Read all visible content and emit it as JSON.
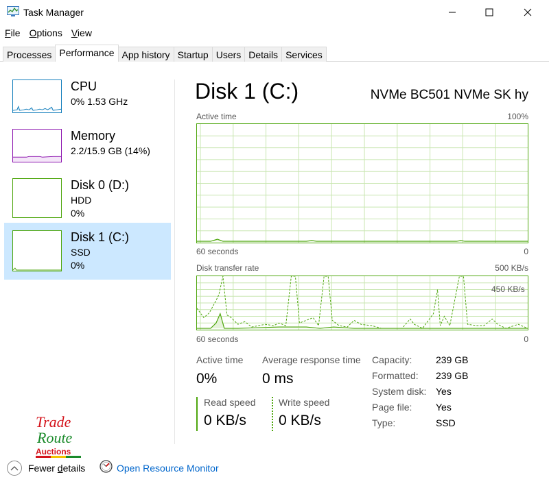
{
  "window": {
    "title": "Task Manager",
    "icon": "task-manager-icon"
  },
  "menu": [
    {
      "key": "F",
      "rest": "ile"
    },
    {
      "key": "O",
      "rest": "ptions"
    },
    {
      "key": "V",
      "rest": "iew"
    }
  ],
  "tabs": [
    "Processes",
    "Performance",
    "App history",
    "Startup",
    "Users",
    "Details",
    "Services"
  ],
  "active_tab": "Performance",
  "sidebar": {
    "items": [
      {
        "title": "CPU",
        "line1": "0%  1.53 GHz",
        "line2": ""
      },
      {
        "title": "Memory",
        "line1": "2.2/15.9 GB (14%)",
        "line2": ""
      },
      {
        "title": "Disk 0 (D:)",
        "line1": "HDD",
        "line2": "0%"
      },
      {
        "title": "Disk 1 (C:)",
        "line1": "SSD",
        "line2": "0%"
      }
    ]
  },
  "detail": {
    "title": "Disk 1 (C:)",
    "model": "NVMe BC501 NVMe SK hy",
    "graph1": {
      "label": "Active time",
      "max": "100%",
      "time": "60 seconds",
      "min": "0"
    },
    "graph2": {
      "label": "Disk transfer rate",
      "max": "500 KB/s",
      "mid": "450 KB/s",
      "time": "60 seconds",
      "min": "0"
    },
    "stats": {
      "active_time_label": "Active time",
      "active_time_value": "0%",
      "response_label": "Average response time",
      "response_value": "0 ms",
      "read_label": "Read speed",
      "read_value": "0 KB/s",
      "write_label": "Write speed",
      "write_value": "0 KB/s"
    },
    "info": [
      {
        "label": "Capacity:",
        "value": "239 GB"
      },
      {
        "label": "Formatted:",
        "value": "239 GB"
      },
      {
        "label": "System disk:",
        "value": "Yes"
      },
      {
        "label": "Page file:",
        "value": "Yes"
      },
      {
        "label": "Type:",
        "value": "SSD"
      }
    ]
  },
  "footer": {
    "fewer_key": "Fewer ",
    "fewer_ul": "d",
    "fewer_rest": "etails",
    "monitor_link": "Open Resource Monitor"
  },
  "watermark": {
    "line1": "Trade",
    "line2": "Route",
    "line3": "Auctions"
  },
  "colors": {
    "cpu": "#117dbb",
    "memory": "#8b12ae",
    "disk": "#4da60c",
    "selected": "#cce8ff",
    "link": "#0066cc"
  }
}
